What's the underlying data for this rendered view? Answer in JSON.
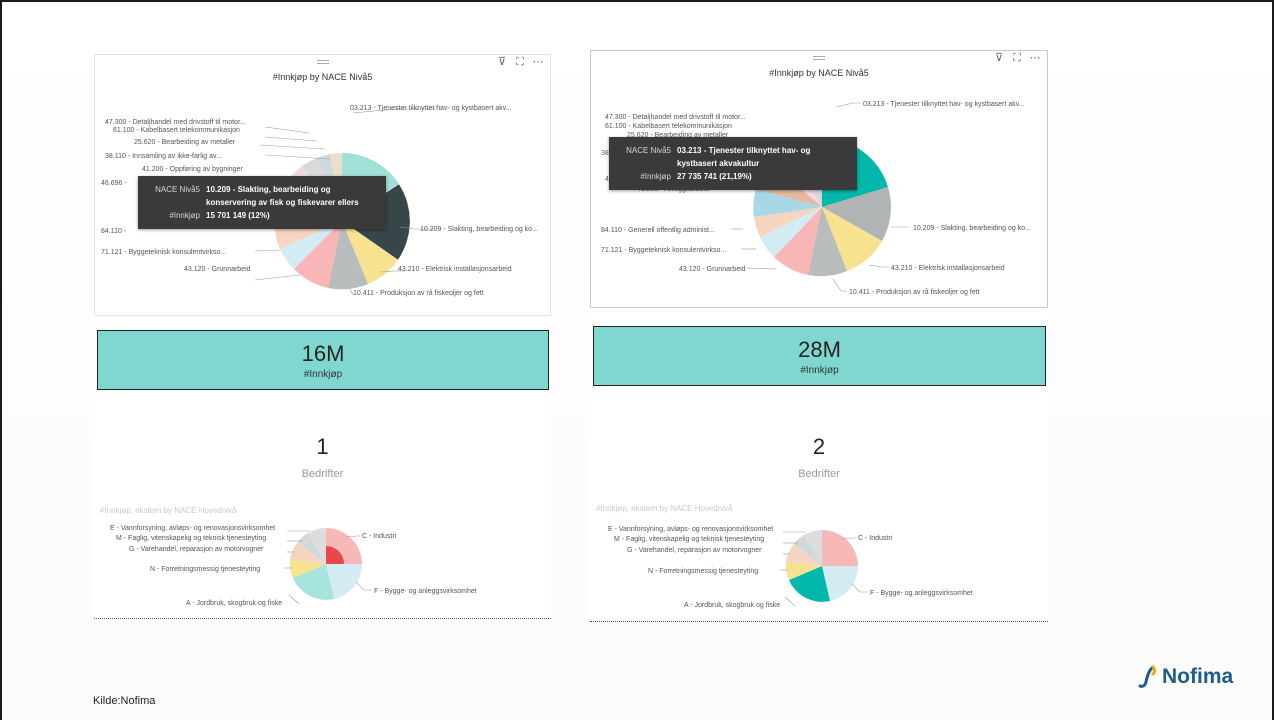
{
  "panels": [
    {
      "chart_title": "#Innkjøp by NACE Nivå5",
      "labels_left": [
        "47.300 - Detaljhandel med drivstoff til motor...",
        "61.100 - Kabelbasert telekommunikasjon",
        "25.620 - Bearbeiding av metaller",
        "38.110 - Innsamling av ikke-farlig av...",
        "41.200 - Oppføring av bygninger",
        "46.696 -",
        "84.110 -",
        "71.121 - Byggeteknisk konsulentvirkso...",
        "43.120 - Grunnarbeid"
      ],
      "labels_right": [
        "03.213 - Tjenester tilknyttet hav- og kystbasert akv...",
        "10.209 - Slakting, bearbeiding og ko...",
        "43.210 - Elektrisk installasjonsarbeid",
        "10.411 - Produksjon av rå fiskeoljer og fett"
      ],
      "tooltip": {
        "key1": "NACE Nivå5",
        "val1": "10.209 - Slakting, bearbeiding og konservering av fisk og fiskevarer ellers",
        "key2": "#Innkjøp",
        "val2": "15 701 149 (12%)"
      },
      "card_value": "16M",
      "card_label": "#Innkjøp",
      "count_value": "1",
      "count_label": "Bedrifter",
      "small_title": "#Innkjøp, ekstern by NACE Hovednivå",
      "small_labels_left": [
        "E - Vannforsyning, avløps- og renovasjonsvirksomhet",
        "M - Faglig, vitenskapelig og teknisk tjenesteyting",
        "G - Varehandel, reparasjon av motorvogner",
        "N - Forretningsmessig tjenesteyting",
        "A - Jordbruk, skogbruk og fiske"
      ],
      "small_labels_right": [
        "C - Industri",
        "F - Bygge- og anleggsvirksomhet"
      ]
    },
    {
      "chart_title": "#Innkjøp by NACE Nivå5",
      "labels_left": [
        "47.300 - Detaljhandel med drivstoff til motor...",
        "61.100 - Kabelbasert telekommunikasjon",
        "25.620 - Bearbeiding av metaller",
        "38.",
        "46.",
        "41.200 - Anleggsarbeid",
        "84.110 - Generell offentlig administ...",
        "71.121 - Byggeteknisk konsulentvirkso...",
        "43.120 - Grunnarbeid"
      ],
      "labels_right": [
        "03.213 - Tjenester tilknyttet hav- og kystbasert akv...",
        "10.209 - Slakting, bearbeiding og ko...",
        "43.210 - Elektrisk installasjonsarbeid",
        "10.411 - Produksjon av rå fiskeoljer og fett"
      ],
      "tooltip": {
        "key1": "NACE Nivå5",
        "val1": "03.213 - Tjenester tilknyttet hav- og kystbasert akvakultur",
        "key2": "#Innkjøp",
        "val2": "27 735 741 (21,19%)"
      },
      "card_value": "28M",
      "card_label": "#Innkjøp",
      "count_value": "2",
      "count_label": "Bedrifter",
      "small_title": "#Innkjøp, ekstern by NACE Hovednivå",
      "small_labels_left": [
        "E - Vannforsyning, avløps- og renovasjonsvirksomhet",
        "M - Faglig, vitenskapelig og teknisk tjenesteyting",
        "G - Varehandel, reparasjon av motorvogner",
        "N - Forretningsmessig tjenesteyting",
        "A - Jordbruk, skogbruk og fiske"
      ],
      "small_labels_right": [
        "C - Industri",
        "F - Bygge- og anleggsvirksomhet"
      ]
    }
  ],
  "icons": {
    "filter": "filter-icon",
    "focus": "focus-mode-icon",
    "more": "more-options-icon",
    "grip": "drag-handle-icon"
  },
  "colors": {
    "teal": "#7fd7cf",
    "highlight_teal": "#01b8aa",
    "highlight_dark": "#374649",
    "logo_blue": "#1f5d8c"
  },
  "footer": {
    "source": "Kilde:Nofima"
  },
  "logo": {
    "text": "Nofima"
  }
}
